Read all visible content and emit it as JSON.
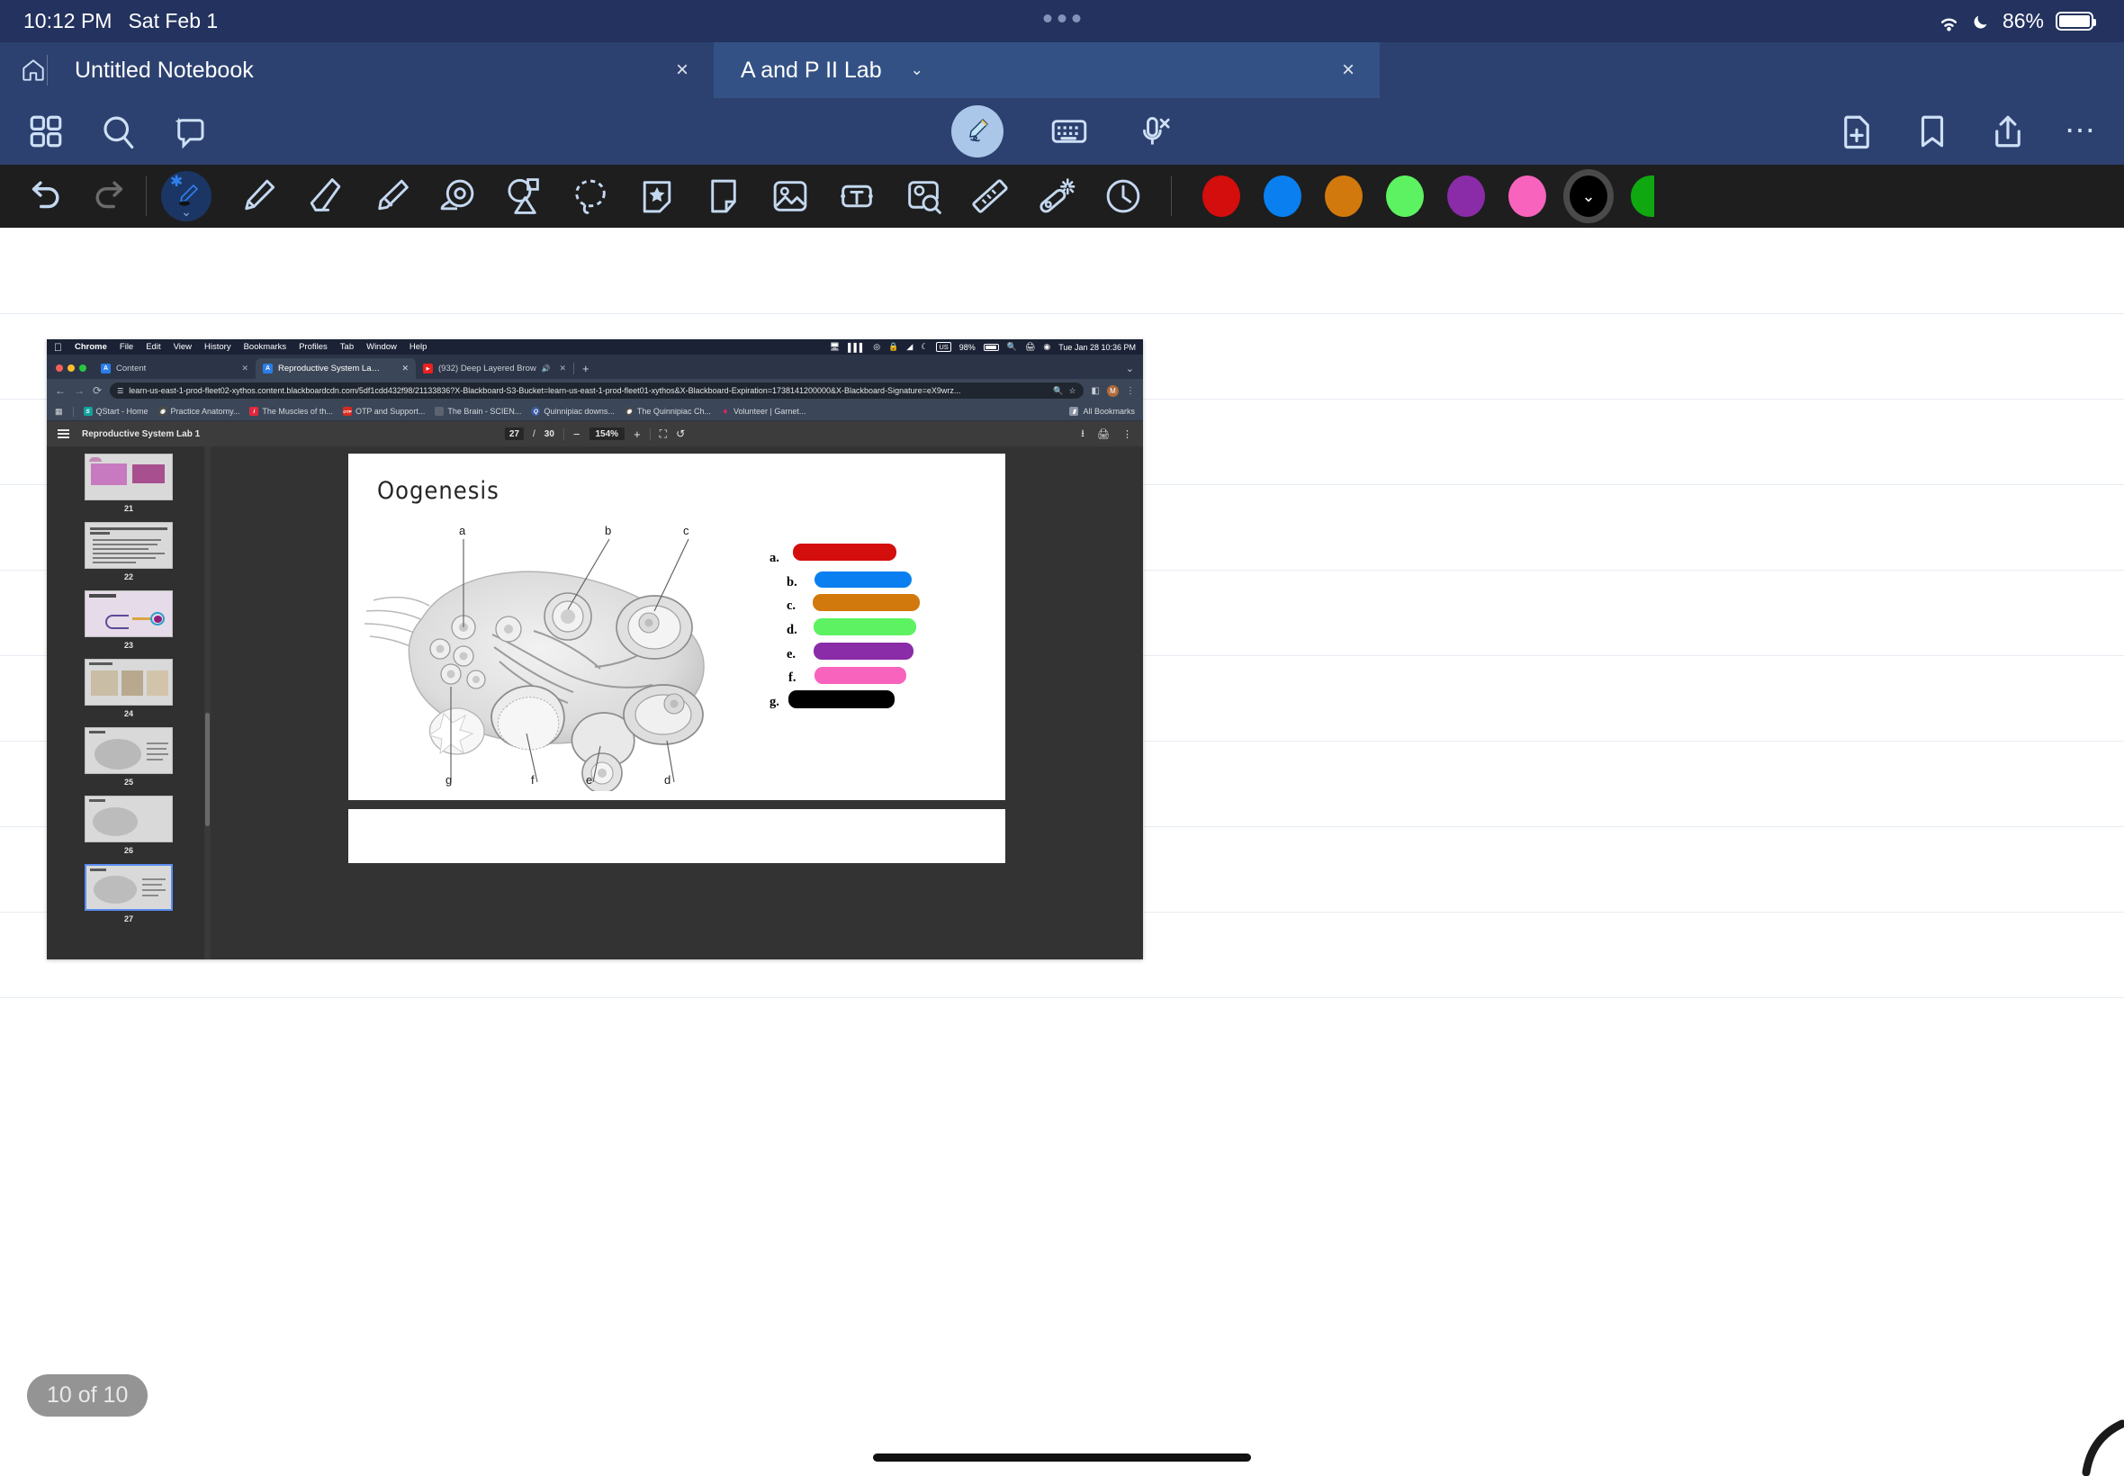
{
  "status_bar": {
    "time": "10:12 PM",
    "date": "Sat Feb 1",
    "battery_percent": "86%",
    "icons": [
      "wifi-icon",
      "moon-icon",
      "battery-icon"
    ]
  },
  "tabs": {
    "home_label": "home-icon",
    "items": [
      {
        "title": "Untitled Notebook",
        "close": "×",
        "active": false
      },
      {
        "title": "A and P II Lab",
        "close": "×",
        "active": true,
        "chevron": "⌄"
      }
    ]
  },
  "top_toolbar": {
    "left": [
      "grid-icon",
      "search-icon",
      "ai-assist-icon"
    ],
    "center": [
      "pen-tool-icon",
      "keyboard-icon",
      "microphone-off-icon"
    ],
    "right": [
      "new-page-icon",
      "bookmark-icon",
      "share-icon",
      "more-icon"
    ]
  },
  "pen_toolbar": {
    "undo": "undo-icon",
    "redo": "redo-icon",
    "tools": [
      "brush-icon",
      "pencil-icon",
      "eraser-icon",
      "highlighter-icon",
      "tape-icon",
      "shape-icon",
      "lasso-icon",
      "sticker-icon",
      "note-icon",
      "image-icon",
      "textbox-icon",
      "image-search-icon",
      "ruler-icon",
      "magic-wand-icon",
      "clock-icon"
    ],
    "selected_tool": "brush-icon",
    "colors": [
      "#d40d0d",
      "#0a7ff0",
      "#d1790c",
      "#5df261",
      "#8a2ba8",
      "#f763bd",
      "#000000",
      "#10a810"
    ],
    "selected_color": "#000000"
  },
  "canvas": {
    "page_counter": "10 of 10"
  },
  "screenshot": {
    "mac_menubar": {
      "apple": "",
      "items": [
        "Chrome",
        "File",
        "Edit",
        "View",
        "History",
        "Bookmarks",
        "Profiles",
        "Tab",
        "Window",
        "Help"
      ],
      "right_icons": [
        "display-icon",
        "equalizer-icon",
        "control-center-icon",
        "lock-icon",
        "wifi-icon",
        "moon-icon"
      ],
      "keyboard_layout": "US",
      "battery_percent": "98%",
      "right_trailing_icons": [
        "search-icon",
        "printer-icon",
        "profile-icon"
      ],
      "clock": "Tue Jan 28  10:36 PM"
    },
    "browser_tabs": [
      {
        "title": "Content",
        "favicon_color": "#2b7de9",
        "favicon_letter": "A",
        "active": false
      },
      {
        "title": "Reproductive System Lab 1",
        "favicon_color": "#2b7de9",
        "favicon_letter": "A",
        "active": true
      },
      {
        "title": "(932) Deep Layered Brow",
        "favicon_color": "#ee1f1f",
        "favicon_letter": "▶",
        "active": false,
        "audio": "🔊"
      }
    ],
    "new_tab_label": "+",
    "url": "learn-us-east-1-prod-fleet02-xythos.content.blackboardcdn.com/5df1cdd432f98/21133836?X-Blackboard-S3-Bucket=learn-us-east-1-prod-fleet01-xythos&X-Blackboard-Expiration=1738141200000&X-Blackboard-Signature=eX9wrz...",
    "url_icons": [
      "site-settings-icon",
      "zoom-icon",
      "bookmark-star-icon"
    ],
    "toolbar_icons": [
      "extensions-icon",
      "profile-avatar",
      "more-vertical-icon"
    ],
    "profile_initial": "M",
    "bookmarks": [
      {
        "label": "QStart - Home",
        "color": "#12a39a",
        "glyph": "S"
      },
      {
        "label": "Practice Anatomy...",
        "color": "#4a4a4a",
        "glyph": "◉"
      },
      {
        "label": "The Muscles of th...",
        "color": "#e0283c",
        "glyph": "i"
      },
      {
        "label": "OTP and Support...",
        "color": "#d92b20",
        "glyph": "OTP"
      },
      {
        "label": "The Brain - SCIEN...",
        "color": "#5c6470",
        "glyph": ""
      },
      {
        "label": "Quinnipiac downs...",
        "color": "#3b5aa0",
        "glyph": "Q"
      },
      {
        "label": "The Quinnipiac Ch...",
        "color": "#4a4a4a",
        "glyph": "◉"
      },
      {
        "label": "Volunteer | Garnet...",
        "color": "#e0245e",
        "glyph": "✦"
      }
    ],
    "all_bookmarks_label": "All Bookmarks",
    "pdf_viewer": {
      "title": "Reproductive System Lab 1",
      "current_page": "27",
      "page_separator": "/",
      "total_pages": "30",
      "zoom": "154%",
      "zoom_out": "−",
      "zoom_in": "+",
      "fit_icon": "fit-page-icon",
      "rotate_icon": "rotate-icon",
      "download_icon": "download-icon",
      "print_icon": "print-icon",
      "more_icon": "more-vertical-icon",
      "menu_icon": "hamburger-icon",
      "thumbnails": [
        {
          "page": "21",
          "kind": "histology"
        },
        {
          "page": "22",
          "kind": "text"
        },
        {
          "page": "23",
          "kind": "sperm-diagram"
        },
        {
          "page": "24",
          "kind": "mixed"
        },
        {
          "page": "25",
          "kind": "ovary"
        },
        {
          "page": "26",
          "kind": "ovary"
        },
        {
          "page": "27",
          "kind": "ovary-current",
          "current": true
        }
      ]
    },
    "page_content": {
      "title": "Oogenesis",
      "diagram_labels_top": [
        "a",
        "b",
        "c"
      ],
      "diagram_labels_bottom": [
        "g",
        "f",
        "e",
        "d"
      ],
      "answer_key": [
        {
          "letter": "a.",
          "color": "#d40d0d"
        },
        {
          "letter": "b.",
          "color": "#0a7ff0"
        },
        {
          "letter": "c.",
          "color": "#d1790c"
        },
        {
          "letter": "d.",
          "color": "#5df261"
        },
        {
          "letter": "e.",
          "color": "#8a2ba8"
        },
        {
          "letter": "f.",
          "color": "#f763bd"
        },
        {
          "letter": "g.",
          "color": "#000000"
        }
      ]
    }
  }
}
